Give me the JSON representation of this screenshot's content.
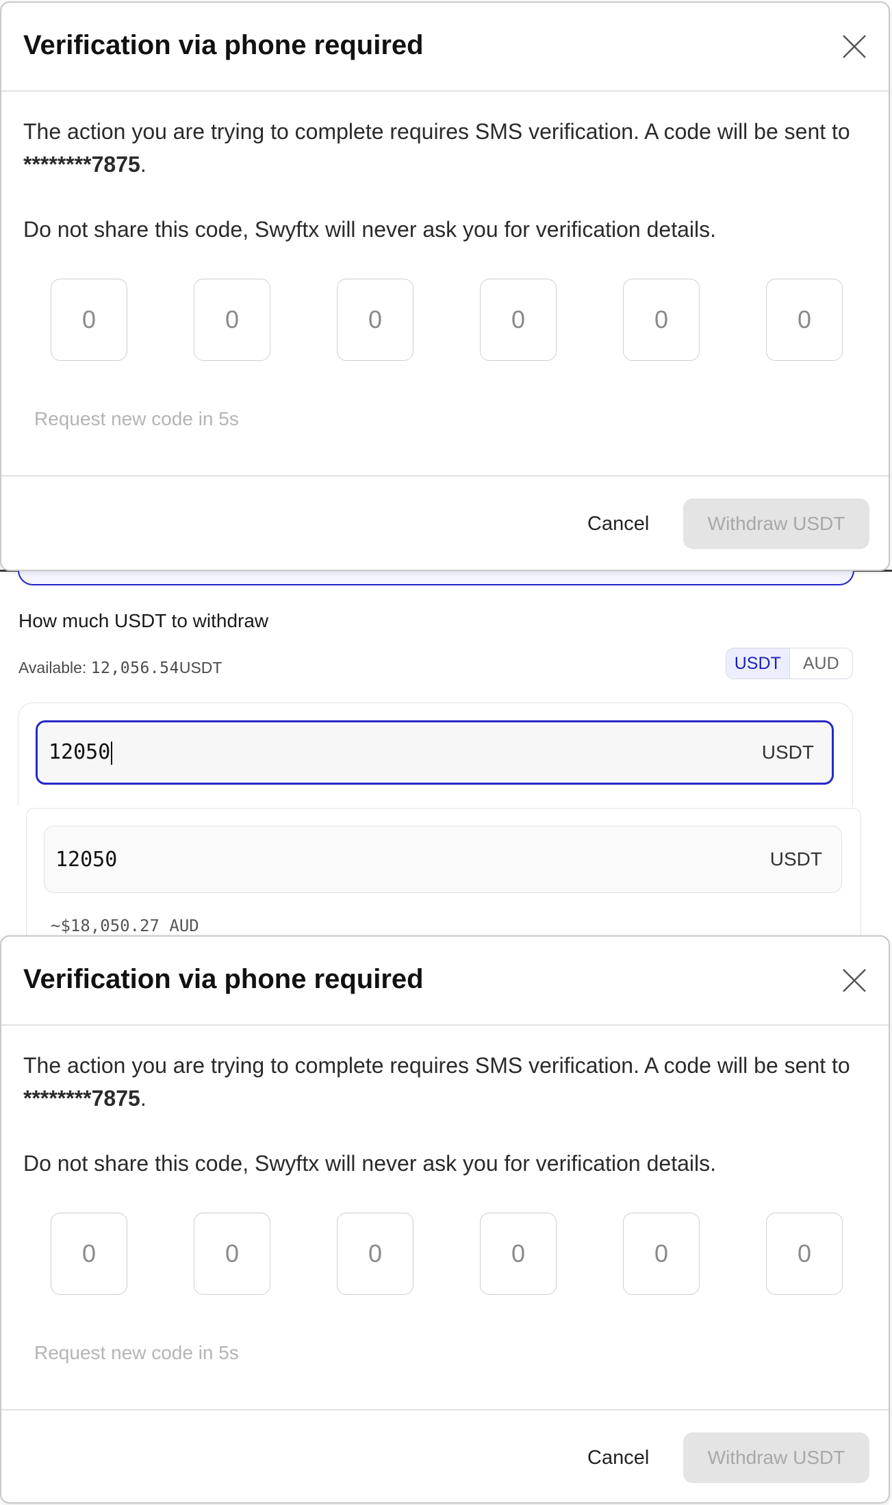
{
  "modal": {
    "title": "Verification via phone required",
    "body_prefix": "The action you are trying to complete requires SMS verification. A code will be sent to ",
    "masked_phone": "********7875",
    "body_suffix": ".",
    "warning": "Do not share this code, Swyftx will never ask you for verification details.",
    "code_digits": [
      "0",
      "0",
      "0",
      "0",
      "0",
      "0"
    ],
    "resend_text": "Request new code in 5s",
    "cancel_label": "Cancel",
    "submit_label": "Withdraw USDT"
  },
  "withdraw_form": {
    "section_label": "How much USDT to withdraw",
    "available_label": "Available:",
    "available_amount": "12,056.54",
    "available_unit": "USDT",
    "toggle_options": [
      "USDT",
      "AUD"
    ],
    "toggle_selected": "USDT",
    "amount_value": "12050",
    "amount_unit": "USDT",
    "amount_value_repeat": "12050",
    "amount_unit_repeat": "USDT",
    "aud_estimate": "~$18,050.27 AUD"
  },
  "colors": {
    "accent": "#2828c8",
    "accent_bg": "#eceefd",
    "disabled_bg": "#e4e4e4",
    "disabled_text": "#a8a8a8"
  }
}
